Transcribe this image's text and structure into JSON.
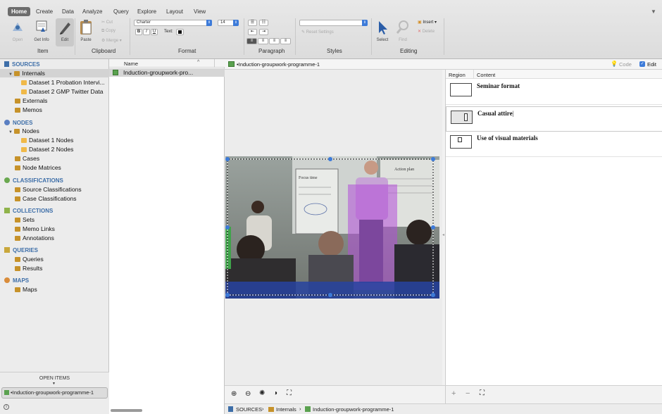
{
  "ribbon": {
    "tabs": [
      "Home",
      "Create",
      "Data",
      "Analyze",
      "Query",
      "Explore",
      "Layout",
      "View"
    ],
    "active_tab": "Home",
    "groups": {
      "item": {
        "label": "Item",
        "buttons": [
          "Open",
          "Get Info",
          "Edit"
        ]
      },
      "clipboard": {
        "label": "Clipboard",
        "paste": "Paste",
        "small": [
          "Cut",
          "Copy",
          "Merge"
        ]
      },
      "format": {
        "label": "Format",
        "font": "Charter",
        "size": "14",
        "bold": "B",
        "italic": "I",
        "underline": "U",
        "text_label": "Text:"
      },
      "paragraph": {
        "label": "Paragraph"
      },
      "styles": {
        "label": "Styles",
        "reset": "Reset Settings"
      },
      "editing": {
        "label": "Editing",
        "select": "Select",
        "find": "Find",
        "insert": "Insert",
        "delete": "Delete"
      }
    }
  },
  "nav": {
    "sources": {
      "heading": "SOURCES",
      "internals": "Internals",
      "dataset1": "Dataset 1 Probation Intervi...",
      "dataset2": "Dataset 2 GMP Twitter Data",
      "externals": "Externals",
      "memos": "Memos"
    },
    "nodes": {
      "heading": "NODES",
      "nodes": "Nodes",
      "d1": "Dataset 1 Nodes",
      "d2": "Dataset 2 Nodes",
      "cases": "Cases",
      "matrices": "Node Matrices"
    },
    "classifications": {
      "heading": "CLASSIFICATIONS",
      "source": "Source Classifications",
      "case": "Case Classifications"
    },
    "collections": {
      "heading": "COLLECTIONS",
      "sets": "Sets",
      "memo_links": "Memo Links",
      "annotations": "Annotations"
    },
    "queries": {
      "heading": "QUERIES",
      "queries": "Queries",
      "results": "Results"
    },
    "maps": {
      "heading": "MAPS",
      "maps": "Maps"
    },
    "open_items": {
      "heading": "OPEN ITEMS",
      "item": "•Induction-groupwork-programme-1"
    }
  },
  "list": {
    "column": "Name",
    "row": "Induction-groupwork-pro..."
  },
  "viewer": {
    "title": "•Induction-groupwork-programme-1",
    "code_label": "Code",
    "edit_label": "Edit",
    "region_col": "Region",
    "content_col": "Content",
    "rows": [
      {
        "content": "Seminar format"
      },
      {
        "content": "Casual attire"
      },
      {
        "content": "Use of visual materials"
      }
    ],
    "photo_texts": [
      "Focus time",
      "Action plan"
    ]
  },
  "breadcrumb": [
    "SOURCES",
    "Internals",
    "Induction-groupwork-programme-1"
  ],
  "colors": {
    "accent": "#3d7bd9",
    "highlight": "#b24fd8",
    "folder": "#f0b949"
  }
}
